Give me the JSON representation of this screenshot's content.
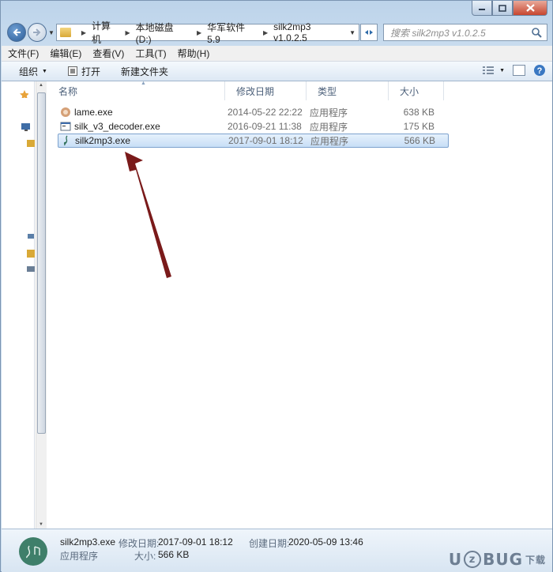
{
  "address_bar": {
    "crumbs": [
      "计算机",
      "本地磁盘 (D:)",
      "华军软件5.9",
      "silk2mp3 v1.0.2.5"
    ]
  },
  "search": {
    "placeholder": "搜索 silk2mp3 v1.0.2.5"
  },
  "menu": [
    "文件(F)",
    "编辑(E)",
    "查看(V)",
    "工具(T)",
    "帮助(H)"
  ],
  "toolbar": {
    "organize": "组织",
    "open": "打开",
    "new_folder": "新建文件夹"
  },
  "columns": {
    "name": "名称",
    "modified": "修改日期",
    "type": "类型",
    "size": "大小"
  },
  "files": [
    {
      "name": "lame.exe",
      "modified": "2014-05-22 22:22",
      "type": "应用程序",
      "size": "638 KB",
      "icon": "lame-app-icon"
    },
    {
      "name": "silk_v3_decoder.exe",
      "modified": "2016-09-21 11:38",
      "type": "应用程序",
      "size": "175 KB",
      "icon": "console-app-icon"
    },
    {
      "name": "silk2mp3.exe",
      "modified": "2017-09-01 18:12",
      "type": "应用程序",
      "size": "566 KB",
      "icon": "music-note-icon",
      "selected": true
    }
  ],
  "details": {
    "filename": "silk2mp3.exe",
    "modified_label": "修改日期:",
    "modified_value": "2017-09-01 18:12",
    "created_label": "创建日期:",
    "created_value": "2020-05-09 13:46",
    "type": "应用程序",
    "size_label": "大小:",
    "size_value": "566 KB"
  },
  "watermark": {
    "text_left": "U",
    "text_mid": "BUG",
    "text_right": "下载"
  },
  "colors": {
    "selection": "#c7def6",
    "arrow": "#7a1a1a",
    "accent": "#2c5d98"
  }
}
